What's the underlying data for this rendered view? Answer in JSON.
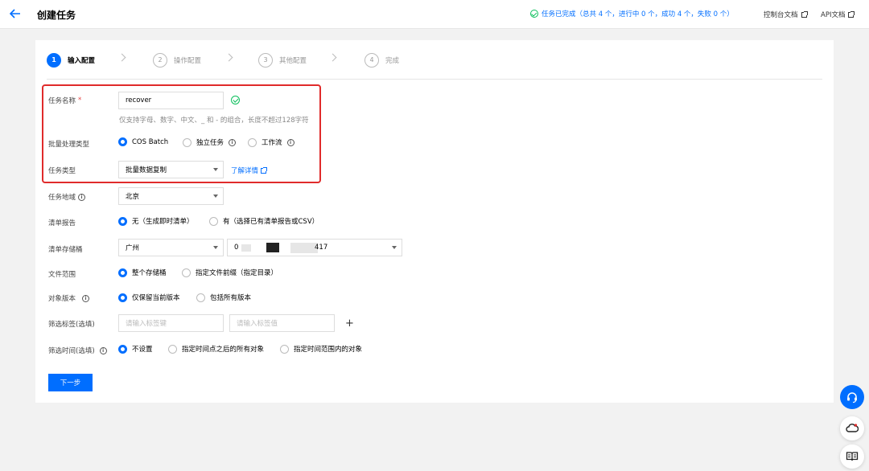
{
  "header": {
    "title": "创建任务",
    "status": "任务已完成（总共 4 个，进行中 0 个，成功 4 个，失败 0 个）",
    "console_doc": "控制台文档",
    "api_doc": "API文档"
  },
  "steps": [
    {
      "num": "1",
      "label": "输入配置"
    },
    {
      "num": "2",
      "label": "操作配置"
    },
    {
      "num": "3",
      "label": "其他配置"
    },
    {
      "num": "4",
      "label": "完成"
    }
  ],
  "form": {
    "task_name": {
      "label": "任务名称",
      "required_mark": "*",
      "value": "recover",
      "hint": "仅支持字母、数字、中文、_ 和 - 的组合，长度不超过128字符"
    },
    "batch_type": {
      "label": "批量处理类型",
      "options": [
        "COS Batch",
        "独立任务",
        "工作流"
      ]
    },
    "task_type": {
      "label": "任务类型",
      "value": "批量数据复制",
      "link": "了解详情"
    },
    "region": {
      "label": "任务地域",
      "value": "北京"
    },
    "manifest_report": {
      "label": "清单报告",
      "options": [
        "无（生成即时清单）",
        "有（选择已有清单报告或CSV）"
      ]
    },
    "manifest_bucket": {
      "label": "清单存储桶",
      "region_value": "广州",
      "bucket_prefix": "0",
      "bucket_suffix": "417"
    },
    "file_scope": {
      "label": "文件范围",
      "options": [
        "整个存储桶",
        "指定文件前缀（指定目录）"
      ]
    },
    "object_version": {
      "label": "对象版本",
      "options": [
        "仅保留当前版本",
        "包括所有版本"
      ]
    },
    "filter_tags": {
      "label": "筛选标签(选填)",
      "key_placeholder": "请输入标签键",
      "value_placeholder": "请输入标签值",
      "add": "+"
    },
    "filter_time": {
      "label": "筛选时间(选填)",
      "options": [
        "不设置",
        "指定时间点之后的所有对象",
        "指定时间范围内的对象"
      ]
    }
  },
  "actions": {
    "next": "下一步"
  },
  "info_glyph": "i",
  "colors": {
    "accent": "#006eff",
    "success": "#0abf5b",
    "highlight": "#e02b2b"
  }
}
